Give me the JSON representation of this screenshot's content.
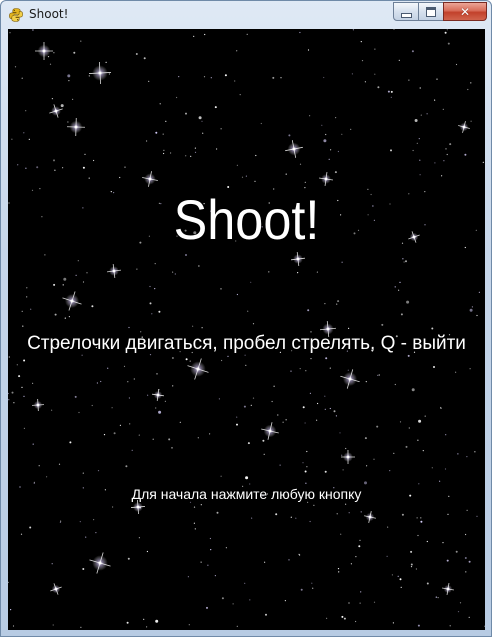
{
  "window": {
    "title": "Shoot!",
    "app_icon": "python-snake-icon",
    "controls": {
      "minimize_icon": "minimize-icon",
      "maximize_icon": "maximize-icon",
      "close_label": "✕"
    }
  },
  "game": {
    "title": "Shoot!",
    "controls_hint": "Стрелочки двигаться, пробел стрелять, Q - выйти",
    "start_prompt": "Для начала нажмите любую кнопку",
    "background_color": "#000000",
    "text_color": "#ffffff"
  }
}
